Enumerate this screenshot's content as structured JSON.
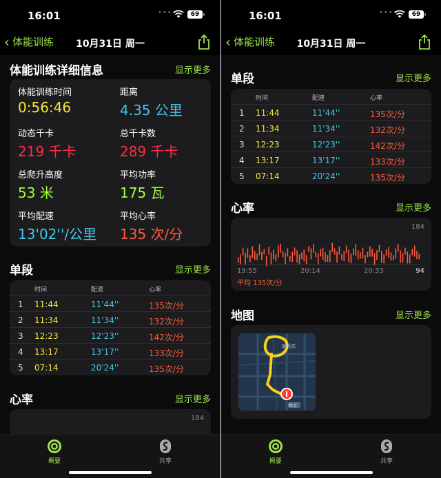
{
  "colors": {
    "accent": "#9ee34b",
    "yellow": "#f6e53b",
    "cyan": "#3fc8e8",
    "red": "#ff2d46",
    "green": "#a6ff3a",
    "orange": "#ff5a3c"
  },
  "left": {
    "status": {
      "time": "16:01",
      "battery": "69"
    },
    "nav": {
      "back": "体能训练",
      "title": "10月31日 周一"
    },
    "details": {
      "title": "体能训练详细信息",
      "more": "显示更多",
      "metrics": [
        {
          "label": "体能训练时间",
          "value": "0:56:46",
          "color": "yellow"
        },
        {
          "label": "距离",
          "value": "4.35 公里",
          "color": "cyan"
        },
        {
          "label": "动态千卡",
          "value": "219 千卡",
          "color": "red"
        },
        {
          "label": "总千卡数",
          "value": "289 千卡",
          "color": "red"
        },
        {
          "label": "总爬升高度",
          "value": "53 米",
          "color": "green"
        },
        {
          "label": "平均功率",
          "value": "175 瓦",
          "color": "green"
        },
        {
          "label": "平均配速",
          "value": "13'02''/公里",
          "color": "cyan"
        },
        {
          "label": "平均心率",
          "value": "135 次/分",
          "color": "orange"
        }
      ]
    },
    "splits_section": {
      "title": "单段",
      "more": "显示更多"
    },
    "hr_section": {
      "title": "心率",
      "more": "显示更多",
      "max": "184"
    },
    "tabs": [
      "概要",
      "共享"
    ]
  },
  "right": {
    "status": {
      "time": "16:01",
      "battery": "69"
    },
    "nav": {
      "back": "体能训练",
      "title": "10月31日 周一"
    },
    "splits_section": {
      "title": "单段",
      "more": "显示更多"
    },
    "hr_section": {
      "title": "心率",
      "more": "显示更多",
      "max": "184",
      "min": "94",
      "times": [
        "19:55",
        "20:14",
        "20:33"
      ],
      "avg": "平均 135次/分"
    },
    "map_section": {
      "title": "地图",
      "more": "显示更多",
      "street": "朝阳东",
      "pin_tag": "终点"
    },
    "tabs": [
      "概要",
      "共享"
    ]
  },
  "splits": {
    "headers": [
      "时间",
      "配速",
      "心率"
    ],
    "rows": [
      {
        "n": "1",
        "time": "11:44",
        "pace": "11'44''",
        "hr": "135次/分"
      },
      {
        "n": "2",
        "time": "11:34",
        "pace": "11'34''",
        "hr": "132次/分"
      },
      {
        "n": "3",
        "time": "12:23",
        "pace": "12'23''",
        "hr": "142次/分"
      },
      {
        "n": "4",
        "time": "13:17",
        "pace": "13'17''",
        "hr": "133次/分"
      },
      {
        "n": "5",
        "time": "07:14",
        "pace": "20'24''",
        "hr": "135次/分"
      }
    ]
  },
  "chart_data": {
    "type": "bar",
    "title": "心率",
    "ylim": [
      94,
      184
    ],
    "x_ticks": [
      "19:55",
      "20:14",
      "20:33"
    ],
    "values": [
      112,
      120,
      140,
      125,
      138,
      118,
      144,
      130,
      122,
      150,
      128,
      136,
      116,
      142,
      126,
      134,
      120,
      146,
      152,
      130,
      124,
      138,
      115,
      128,
      140,
      132,
      120,
      126,
      134,
      118,
      145,
      138,
      150,
      128,
      122,
      136,
      140,
      126,
      118,
      132,
      154,
      138,
      128,
      144,
      120,
      130,
      146,
      134,
      122,
      138,
      150,
      132,
      126,
      140,
      118,
      128,
      144,
      136,
      124,
      132,
      148,
      130,
      120,
      134,
      142,
      126,
      118,
      138,
      150,
      132,
      124,
      140,
      128,
      120,
      136,
      146,
      130,
      122
    ]
  }
}
